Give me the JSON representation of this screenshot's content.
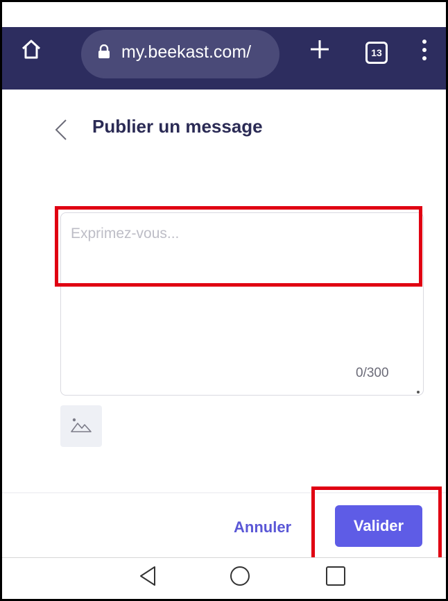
{
  "browser": {
    "url": "my.beekast.com/",
    "tab_count": "13",
    "icons": [
      "home-icon",
      "lock-icon",
      "new-tab-plus-icon",
      "tab-switcher-icon",
      "overflow-menu-icon"
    ],
    "bar_color": "#2d2d5f"
  },
  "page": {
    "title": "Publier un message",
    "back_icon": "chevron-left-icon"
  },
  "composer": {
    "placeholder": "Exprimez-vous...",
    "value": "",
    "counter": "0/300",
    "image_button_icon": "image-icon"
  },
  "actions": {
    "cancel_label": "Annuler",
    "submit_label": "Valider",
    "accent_color": "#5e5ce6"
  },
  "highlights": {
    "color": "#e00012",
    "targets": [
      "composer-textarea",
      "submit-button"
    ]
  },
  "android_nav": {
    "icons": [
      "nav-back-icon",
      "nav-home-icon",
      "nav-recents-icon"
    ]
  }
}
